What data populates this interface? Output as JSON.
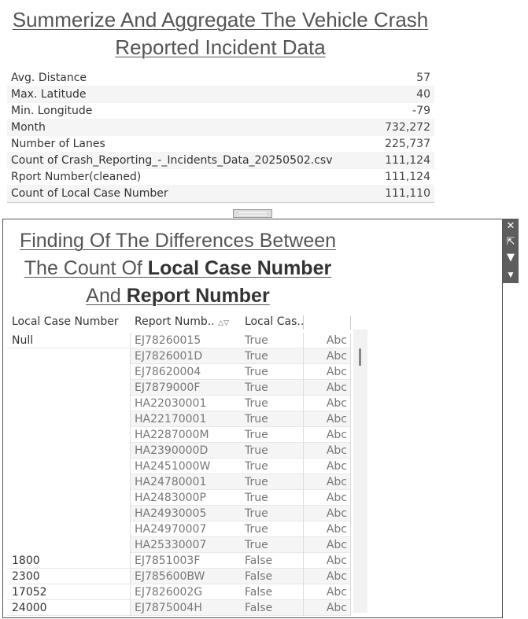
{
  "title1_line1": "Summerize And Aggregate The Vehicle Crash",
  "title1_line2": "Reported  Incident Data",
  "summary": [
    {
      "label": "Avg. Distance",
      "value": "57"
    },
    {
      "label": "Max. Latitude",
      "value": "40"
    },
    {
      "label": "Min. Longitude",
      "value": "-79"
    },
    {
      "label": "Month",
      "value": "732,272"
    },
    {
      "label": "Number of Lanes",
      "value": "225,737"
    },
    {
      "label": "Count of Crash_Reporting_-_Incidents_Data_20250502.csv",
      "value": "111,124"
    },
    {
      "label": "Rport Number(cleaned)",
      "value": "111,124"
    },
    {
      "label": "Count of Local Case Number",
      "value": "111,110"
    }
  ],
  "title2": {
    "line1": "Finding Of The Differences Between",
    "line2_pre": "The Count Of ",
    "line2_bold": "Local Case Number",
    "line3_pre": "And ",
    "line3_bold": "Report Number"
  },
  "table": {
    "headers": [
      "Local Case Number",
      "Report Numb..",
      "Local Cas.."
    ],
    "sort_icon": "sort-icon",
    "rows": [
      {
        "local": "Null",
        "report": "EJ78260015",
        "flag": "True",
        "abc": "Abc"
      },
      {
        "local": "",
        "report": "EJ7826001D",
        "flag": "True",
        "abc": "Abc"
      },
      {
        "local": "",
        "report": "EJ78620004",
        "flag": "True",
        "abc": "Abc"
      },
      {
        "local": "",
        "report": "EJ7879000F",
        "flag": "True",
        "abc": "Abc"
      },
      {
        "local": "",
        "report": "HA22030001",
        "flag": "True",
        "abc": "Abc"
      },
      {
        "local": "",
        "report": "HA22170001",
        "flag": "True",
        "abc": "Abc"
      },
      {
        "local": "",
        "report": "HA2287000M",
        "flag": "True",
        "abc": "Abc"
      },
      {
        "local": "",
        "report": "HA2390000D",
        "flag": "True",
        "abc": "Abc"
      },
      {
        "local": "",
        "report": "HA2451000W",
        "flag": "True",
        "abc": "Abc"
      },
      {
        "local": "",
        "report": "HA24780001",
        "flag": "True",
        "abc": "Abc"
      },
      {
        "local": "",
        "report": "HA2483000P",
        "flag": "True",
        "abc": "Abc"
      },
      {
        "local": "",
        "report": "HA24930005",
        "flag": "True",
        "abc": "Abc"
      },
      {
        "local": "",
        "report": "HA24970007",
        "flag": "True",
        "abc": "Abc"
      },
      {
        "local": "",
        "report": "HA25330007",
        "flag": "True",
        "abc": "Abc"
      },
      {
        "local": "1800",
        "report": "EJ7851003F",
        "flag": "False",
        "abc": "Abc"
      },
      {
        "local": "2300",
        "report": "EJ785600BW",
        "flag": "False",
        "abc": "Abc"
      },
      {
        "local": "17052",
        "report": "EJ7826002G",
        "flag": "False",
        "abc": "Abc"
      },
      {
        "local": "24000",
        "report": "EJ7875004H",
        "flag": "False",
        "abc": "Abc"
      }
    ]
  },
  "toolbar": {
    "close_icon": "close-icon",
    "popout_icon": "popout-icon",
    "filter_icon": "filter-icon",
    "menu_icon": "dropdown-menu-icon"
  },
  "colors": {
    "stripe": "#f5f5f5",
    "toolbar": "#5d5d5d",
    "border": "#555555"
  }
}
